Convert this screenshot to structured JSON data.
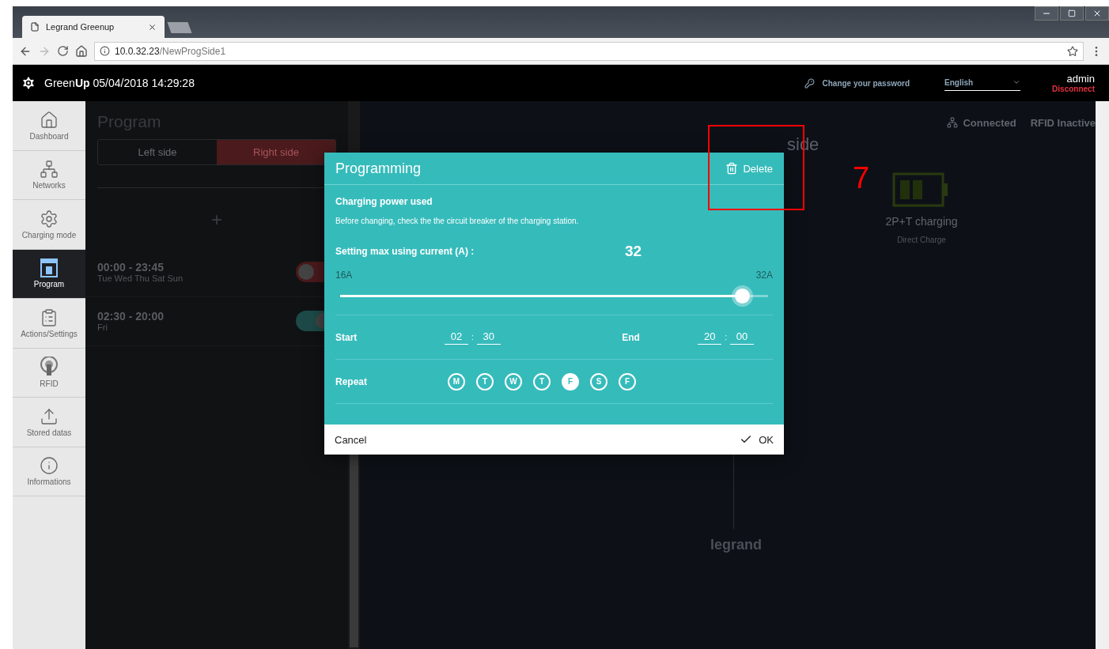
{
  "browser": {
    "tab_title": "Legrand Greenup",
    "address_host": "10.0.32.23",
    "address_path": "/NewProgSide1"
  },
  "header": {
    "brand": "Green**Up** 05/04/2018 14:29:28",
    "change_password": "Change your password",
    "language": "English",
    "user": "admin",
    "disconnect": "Disconnect"
  },
  "sidebar": {
    "items": [
      {
        "kind": "home",
        "label": "Dashboard",
        "selected": false
      },
      {
        "kind": "network",
        "label": "Networks",
        "selected": false
      },
      {
        "kind": "gear",
        "label": "Charging mode",
        "selected": false
      },
      {
        "kind": "calendar",
        "label": "Program",
        "selected": true
      },
      {
        "kind": "clipboard",
        "label": "Actions/Settings",
        "selected": false
      },
      {
        "kind": "rfid",
        "label": "RFID",
        "selected": false
      },
      {
        "kind": "upload",
        "label": "Stored datas",
        "selected": false
      },
      {
        "kind": "info",
        "label": "Informations",
        "selected": false
      }
    ]
  },
  "program_panel": {
    "title": "Program",
    "tabs": [
      {
        "label": "Left side",
        "selected": false
      },
      {
        "label": "Right side",
        "selected": true
      }
    ],
    "add": "+",
    "programs": [
      {
        "time": "00:00 - 23:45",
        "days": "Tue Wed Thu Sat Sun",
        "on": false
      },
      {
        "time": "02:30 - 20:00",
        "days": "Fri",
        "on": true
      }
    ]
  },
  "status_panel": {
    "heading": "side",
    "network": "Connected",
    "rfid": "RFID Inactive",
    "mode": "2P+T charging",
    "mode_detail": "Direct Charge",
    "logo": "legrand"
  },
  "modal": {
    "title": "Programming",
    "delete": "Delete",
    "section": "Charging power used",
    "note": "Before changing, check the the circuit breaker of the charging station.",
    "setting_label": "Setting max using current (A) :",
    "value": "32",
    "min": "16A",
    "max": "32A",
    "level": 0.94,
    "time_separator": ":",
    "start_label": "Start",
    "start_hours": "02",
    "start_minutes": "30",
    "end_label": "End",
    "end_hours": "20",
    "end_minutes": "00",
    "repeat_label": "Repeat",
    "days": [
      {
        "label": "M",
        "selected": false
      },
      {
        "label": "T",
        "selected": false
      },
      {
        "label": "W",
        "selected": false
      },
      {
        "label": "T",
        "selected": false
      },
      {
        "label": "F",
        "selected": true
      },
      {
        "label": "S",
        "selected": false
      },
      {
        "label": "F",
        "selected": false
      }
    ],
    "cancel": "Cancel",
    "ok": "OK"
  },
  "annotation": {
    "number": "7"
  }
}
